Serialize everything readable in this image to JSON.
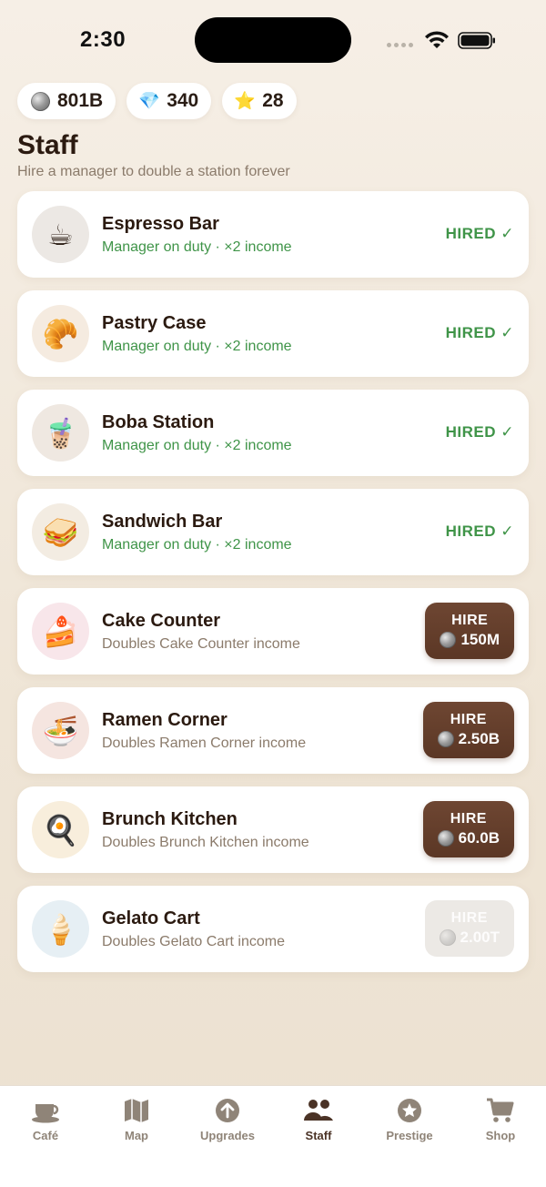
{
  "status": {
    "time": "2:30"
  },
  "currency": {
    "coins": "801B",
    "gems": "340",
    "stars": "28"
  },
  "page": {
    "title": "Staff",
    "subtitle": "Hire a manager to double a station forever"
  },
  "stations": [
    {
      "name": "Espresso Bar",
      "desc": "Manager on duty · ×2 income",
      "status": "HIRED ✓",
      "icon": "coffee-cup-icon",
      "emoji": "☕"
    },
    {
      "name": "Pastry Case",
      "desc": "Manager on duty · ×2 income",
      "status": "HIRED ✓",
      "icon": "croissant-icon",
      "emoji": "🥐"
    },
    {
      "name": "Boba Station",
      "desc": "Manager on duty · ×2 income",
      "status": "HIRED ✓",
      "icon": "bubble-tea-icon",
      "emoji": "🧋"
    },
    {
      "name": "Sandwich Bar",
      "desc": "Manager on duty · ×2 income",
      "status": "HIRED ✓",
      "icon": "sandwich-icon",
      "emoji": "🥪"
    },
    {
      "name": "Cake Counter",
      "desc": "Doubles Cake Counter income",
      "hire_label": "HIRE",
      "cost": "150M",
      "icon": "cake-slice-icon",
      "emoji": "🍰"
    },
    {
      "name": "Ramen Corner",
      "desc": "Doubles Ramen Corner income",
      "hire_label": "HIRE",
      "cost": "2.50B",
      "icon": "ramen-bowl-icon",
      "emoji": "🍜"
    },
    {
      "name": "Brunch Kitchen",
      "desc": "Doubles Brunch Kitchen income",
      "hire_label": "HIRE",
      "cost": "60.0B",
      "icon": "frying-pan-egg-icon",
      "emoji": "🍳"
    },
    {
      "name": "Gelato Cart",
      "desc": "Doubles Gelato Cart income",
      "hire_label": "HIRE",
      "cost": "2.00T",
      "icon": "ice-cream-cone-icon",
      "emoji": "🍦"
    }
  ],
  "tabs": [
    {
      "label": "Café",
      "icon": "cafe-cup-icon"
    },
    {
      "label": "Map",
      "icon": "map-icon"
    },
    {
      "label": "Upgrades",
      "icon": "upgrade-arrow-icon"
    },
    {
      "label": "Staff",
      "icon": "staff-people-icon",
      "active": true
    },
    {
      "label": "Prestige",
      "icon": "prestige-star-icon"
    },
    {
      "label": "Shop",
      "icon": "shopping-cart-icon"
    }
  ],
  "colors": {
    "accent_brown": "#5b3725",
    "hired_green": "#3f9448",
    "background": "#f2e9dd"
  }
}
